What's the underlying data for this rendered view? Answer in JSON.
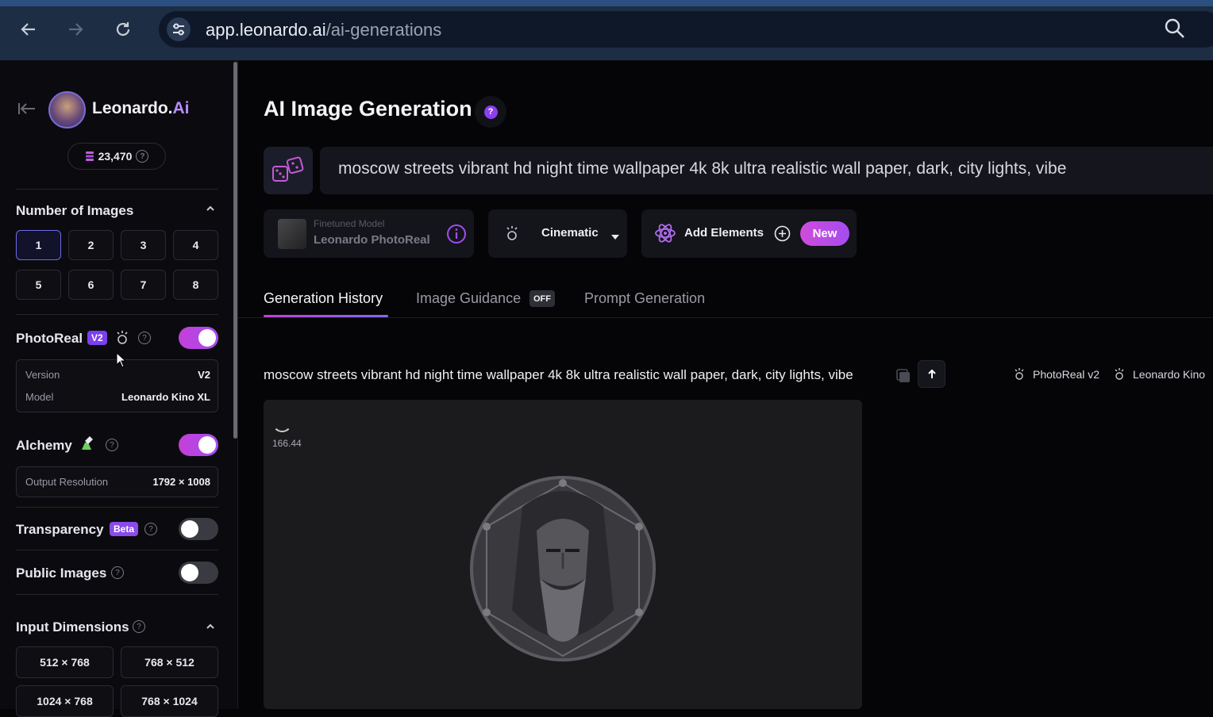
{
  "browser": {
    "url_host": "app.leonardo.ai",
    "url_path": "/ai-generations"
  },
  "sidebar": {
    "brand_name": "Leonardo.",
    "brand_suffix": "Ai",
    "credits": "23,470",
    "number_of_images": {
      "title": "Number of Images",
      "options": [
        "1",
        "2",
        "3",
        "4",
        "5",
        "6",
        "7",
        "8"
      ],
      "selected": "1"
    },
    "photoreal": {
      "label": "PhotoReal",
      "badge": "V2",
      "enabled": true,
      "version_key": "Version",
      "version_value": "V2",
      "model_key": "Model",
      "model_value": "Leonardo Kino XL"
    },
    "alchemy": {
      "label": "Alchemy",
      "enabled": true,
      "resolution_key": "Output Resolution",
      "resolution_value": "1792 × 1008"
    },
    "transparency": {
      "label": "Transparency",
      "badge": "Beta",
      "enabled": false
    },
    "public_images": {
      "label": "Public Images",
      "enabled": false
    },
    "input_dimensions": {
      "title": "Input Dimensions",
      "options": [
        "512 × 768",
        "768 × 512",
        "1024 × 768",
        "768 × 1024"
      ]
    }
  },
  "main": {
    "title": "AI Image Generation",
    "prompt": "moscow streets vibrant hd night time wallpaper 4k 8k ultra realistic wall paper, dark, city lights, vibe",
    "model_chip": {
      "label": "Finetuned Model",
      "name": "Leonardo PhotoReal"
    },
    "style_chip": "Cinematic",
    "elements_chip": "Add Elements",
    "new_badge": "New",
    "tabs": [
      {
        "label": "Generation History",
        "active": true
      },
      {
        "label": "Image Guidance",
        "badge": "OFF"
      },
      {
        "label": "Prompt Generation"
      }
    ],
    "generation": {
      "prompt": "moscow streets vibrant hd night time wallpaper 4k 8k ultra realistic wall paper, dark, city lights, vibe",
      "tag_photoreal": "PhotoReal v2",
      "tag_model": "Leonardo Kino",
      "elapsed": "166.44"
    }
  },
  "colors": {
    "accent_purple": "#a64df0",
    "toggle_on": "#c43fd8",
    "chrome_bar": "#1d2d44"
  }
}
